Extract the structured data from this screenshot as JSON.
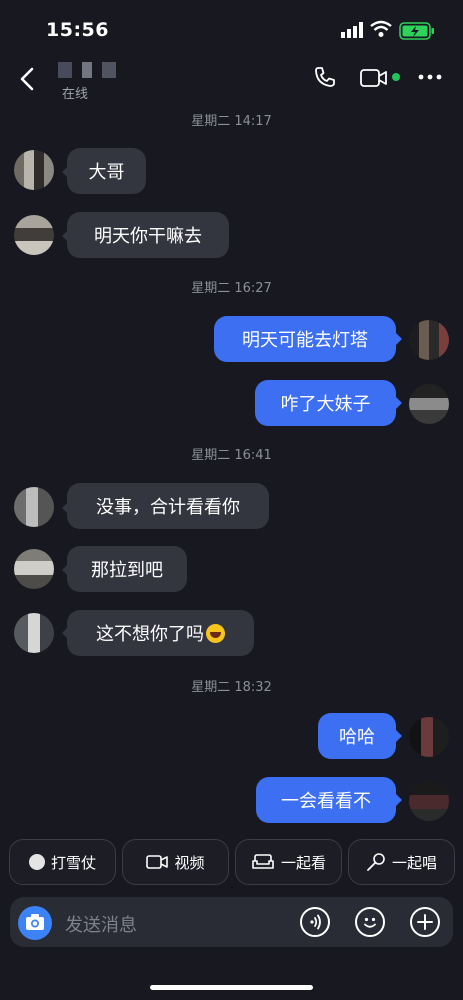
{
  "status_bar": {
    "time": "15:56"
  },
  "header": {
    "status": "在线"
  },
  "timestamps": [
    "星期二 14:17",
    "星期二 16:27",
    "星期二 16:41",
    "星期二 18:32"
  ],
  "messages": [
    {
      "side": "in",
      "text": "大哥"
    },
    {
      "side": "in",
      "text": "明天你干嘛去"
    },
    {
      "side": "out",
      "text": "明天可能去灯塔"
    },
    {
      "side": "out",
      "text": "咋了大妹子"
    },
    {
      "side": "in",
      "text": "没事，合计看看你"
    },
    {
      "side": "in",
      "text": "那拉到吧"
    },
    {
      "side": "in",
      "text": "这不想你了吗",
      "emoji": "rolling-on-floor-laughing"
    },
    {
      "side": "out",
      "text": "哈哈"
    },
    {
      "side": "out",
      "text": "一会看看不"
    }
  ],
  "quick_actions": [
    "打雪仗",
    "视频",
    "一起看",
    "一起唱"
  ],
  "input": {
    "placeholder": "发送消息"
  },
  "colors": {
    "background": "#171820",
    "incoming_bubble": "#33353f",
    "outgoing_bubble": "#3d6ff2",
    "online": "#25c35b",
    "camera": "#3b83f7"
  }
}
